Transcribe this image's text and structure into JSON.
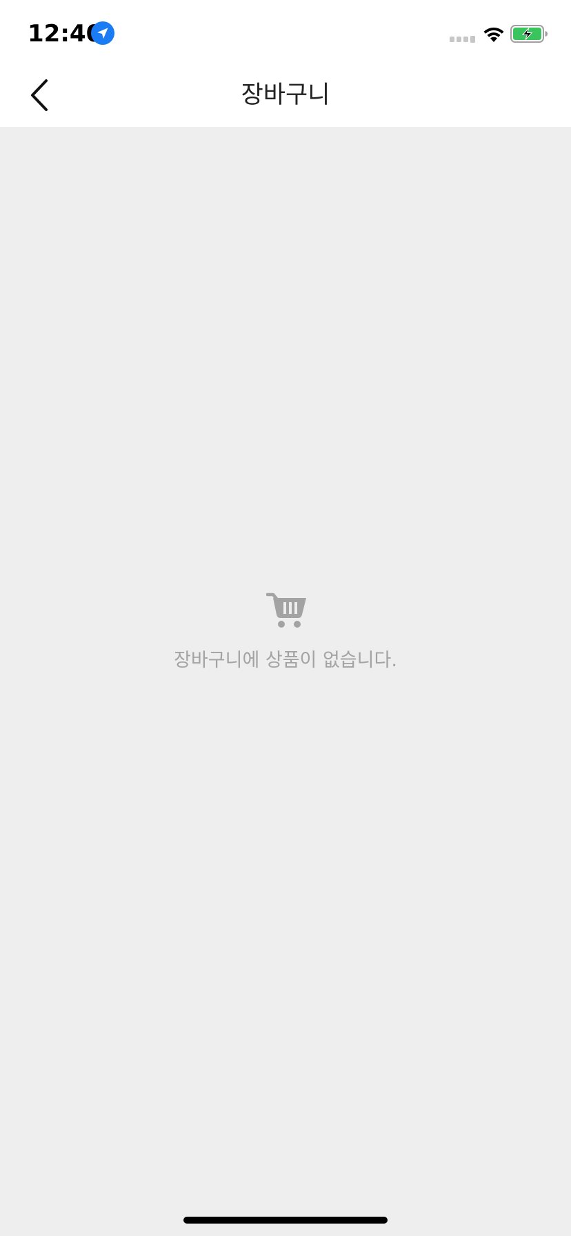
{
  "status_bar": {
    "time": "12:40",
    "location_icon": "location-arrow-icon",
    "signal_icon": "cell-signal-icon",
    "wifi_icon": "wifi-icon",
    "battery_icon": "battery-charging-icon",
    "location_color": "#1a7cf5",
    "battery_color": "#3ac45e"
  },
  "nav": {
    "back_icon": "chevron-left-icon",
    "title": "장바구니"
  },
  "empty_state": {
    "icon": "shopping-cart-icon",
    "message": "장바구니에 상품이 없습니다."
  },
  "colors": {
    "background": "#eeeeee",
    "header_background": "#ffffff",
    "empty_text": "#a3a3a3",
    "icon_gray": "#a3a3a3"
  }
}
